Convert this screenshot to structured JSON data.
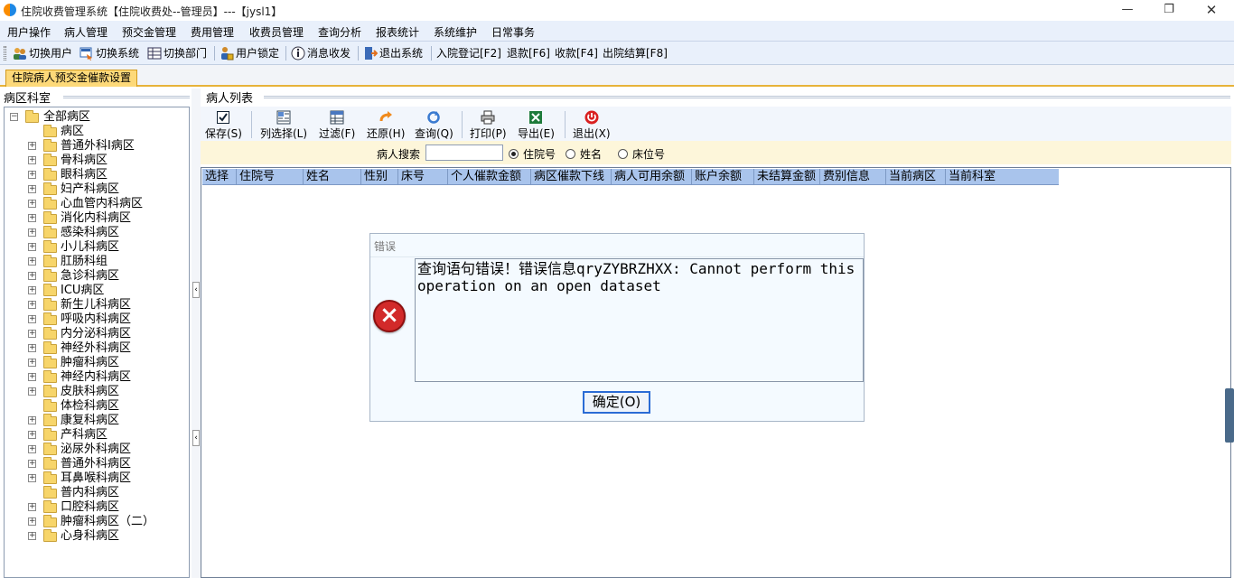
{
  "window": {
    "title": "住院收费管理系统【住院收费处--管理员】---【jysl1】",
    "min_glyph": "—",
    "max_glyph": "❐",
    "close_glyph": "✕"
  },
  "menu": [
    "用户操作",
    "病人管理",
    "预交金管理",
    "费用管理",
    "收费员管理",
    "查询分析",
    "报表统计",
    "系统维护",
    "日常事务"
  ],
  "toolbar": {
    "switch_user": "切换用户",
    "switch_system": "切换系统",
    "switch_dept": "切换部门",
    "user_lock": "用户锁定",
    "messages": "消息收发",
    "exit_system": "退出系统",
    "admission": "入院登记[F2]",
    "refund": "退款[F6]",
    "charge": "收款[F4]",
    "discharge": "出院结算[F8]"
  },
  "tab": {
    "active_label": "住院病人预交金催款设置"
  },
  "left_panel": {
    "title": "病区科室",
    "tree_root": "全部病区",
    "tree_items": [
      {
        "label": "病区",
        "expandable": false
      },
      {
        "label": "普通外科Ⅰ病区",
        "expandable": true
      },
      {
        "label": "骨科病区",
        "expandable": true
      },
      {
        "label": "眼科病区",
        "expandable": true
      },
      {
        "label": "妇产科病区",
        "expandable": true
      },
      {
        "label": "心血管内科病区",
        "expandable": true
      },
      {
        "label": "消化内科病区",
        "expandable": true
      },
      {
        "label": "感染科病区",
        "expandable": true
      },
      {
        "label": "小儿科病区",
        "expandable": true
      },
      {
        "label": "肛肠科组",
        "expandable": true
      },
      {
        "label": "急诊科病区",
        "expandable": true
      },
      {
        "label": "ICU病区",
        "expandable": true
      },
      {
        "label": "新生儿科病区",
        "expandable": true
      },
      {
        "label": "呼吸内科病区",
        "expandable": true
      },
      {
        "label": "内分泌科病区",
        "expandable": true
      },
      {
        "label": "神经外科病区",
        "expandable": true
      },
      {
        "label": "肿瘤科病区",
        "expandable": true
      },
      {
        "label": "神经内科病区",
        "expandable": true
      },
      {
        "label": "皮肤科病区",
        "expandable": true
      },
      {
        "label": "体检科病区",
        "expandable": false
      },
      {
        "label": "康复科病区",
        "expandable": true
      },
      {
        "label": "产科病区",
        "expandable": true
      },
      {
        "label": "泌尿外科病区",
        "expandable": true
      },
      {
        "label": "普通外科病区",
        "expandable": true
      },
      {
        "label": "耳鼻喉科病区",
        "expandable": true
      },
      {
        "label": "普内科病区",
        "expandable": false
      },
      {
        "label": "口腔科病区",
        "expandable": true
      },
      {
        "label": "肿瘤科病区（二）",
        "expandable": true
      },
      {
        "label": "心身科病区",
        "expandable": true
      }
    ]
  },
  "right_panel": {
    "title": "病人列表",
    "buttons": {
      "save": "保存(S)",
      "column_select": "列选择(L)",
      "filter": "过滤(F)",
      "restore": "还原(H)",
      "query": "查询(Q)",
      "print": "打印(P)",
      "export": "导出(E)",
      "exit": "退出(X)"
    },
    "search": {
      "label": "病人搜索",
      "value": "",
      "radio_admission_no": "住院号",
      "radio_name": "姓名",
      "radio_bed_no": "床位号",
      "selected": "住院号"
    },
    "columns": [
      "选择",
      "住院号",
      "姓名",
      "性别",
      "床号",
      "个人催款金额",
      "病区催款下线",
      "病人可用余额",
      "账户余额",
      "未结算金额",
      "费别信息",
      "当前病区",
      "当前科室"
    ]
  },
  "dialog": {
    "title": "错误",
    "message": "查询语句错误！错误信息qryZYBRZHXX: Cannot perform this operation on an open dataset",
    "ok_label": "确定(O)"
  }
}
